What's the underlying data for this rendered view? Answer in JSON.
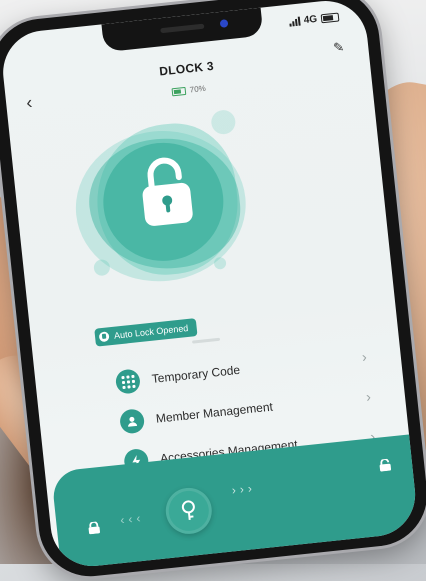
{
  "status_bar": {
    "network": "4G"
  },
  "header": {
    "title": "DLOCK 3",
    "battery_percent": "70%"
  },
  "lock_status": {
    "label": "Auto Lock Opened"
  },
  "menu": {
    "items": [
      {
        "label": "Temporary Code",
        "icon": "keypad-icon"
      },
      {
        "label": "Member Management",
        "icon": "user-icon"
      },
      {
        "label": "Accessories Management",
        "icon": "bolt-icon"
      }
    ]
  },
  "colors": {
    "accent": "#2f9c8c",
    "battery": "#3ca25e"
  }
}
